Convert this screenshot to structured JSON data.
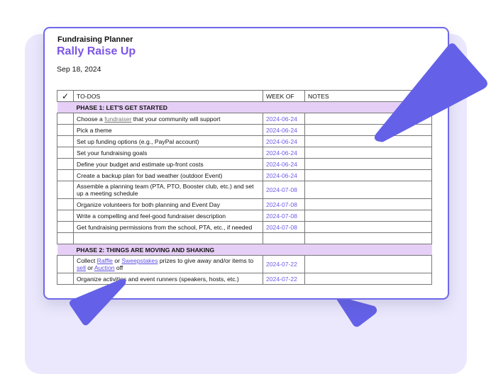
{
  "document": {
    "supertitle": "Fundraising Planner",
    "title": "Rally Raise Up",
    "date": "Sep 18, 2024"
  },
  "table": {
    "headers": {
      "check": "✓",
      "todos": "TO-DOS",
      "week_of": "WEEK OF",
      "notes": "NOTES"
    },
    "phase1": {
      "label": "PHASE 1: LET'S GET STARTED",
      "rows": [
        {
          "pre": "Choose a ",
          "link": "fundraiser",
          "post": " that your community will support",
          "week": "2024-06-24"
        },
        {
          "task": "Pick a theme",
          "week": "2024-06-24"
        },
        {
          "task": "Set up funding options (e.g., PayPal account)",
          "week": "2024-06-24"
        },
        {
          "task": "Set your fundraising goals",
          "week": "2024-06-24"
        },
        {
          "task": "Define your budget and estimate up-front costs",
          "week": "2024-06-24"
        },
        {
          "task": "Create a backup plan for bad weather (outdoor Event)",
          "week": "2024-06-24"
        },
        {
          "task": "Assemble a planning team (PTA, PTO, Booster club, etc.) and set up a meeting schedule",
          "week": "2024-07-08"
        },
        {
          "task": "Organize volunteers for both planning and Event Day",
          "week": "2024-07-08"
        },
        {
          "task": "Write a compelling and feel-good fundraiser description",
          "week": "2024-07-08"
        },
        {
          "task": "Get fundraising permissions from the school, PTA, etc., if needed",
          "week": "2024-07-08"
        }
      ]
    },
    "phase2": {
      "label": "PHASE 2: THINGS ARE MOVING AND SHAKING",
      "rows": [
        {
          "t1": "Collect ",
          "l1": "Raffle",
          "t2": " or ",
          "l2": "Sweepstakes",
          "t3": " prizes to give away and/or items to ",
          "l3": "sell",
          "t4": " or ",
          "l4": "Auction",
          "t5": " off",
          "week": "2024-07-22"
        },
        {
          "task": "Organize activities and event runners (speakers, hosts, etc.)",
          "week": "2024-07-22"
        }
      ]
    }
  },
  "colors": {
    "accent": "#6461e8",
    "title": "#7b55e6",
    "phase_bg": "#e6cff6",
    "background": "#ebe8fd"
  }
}
